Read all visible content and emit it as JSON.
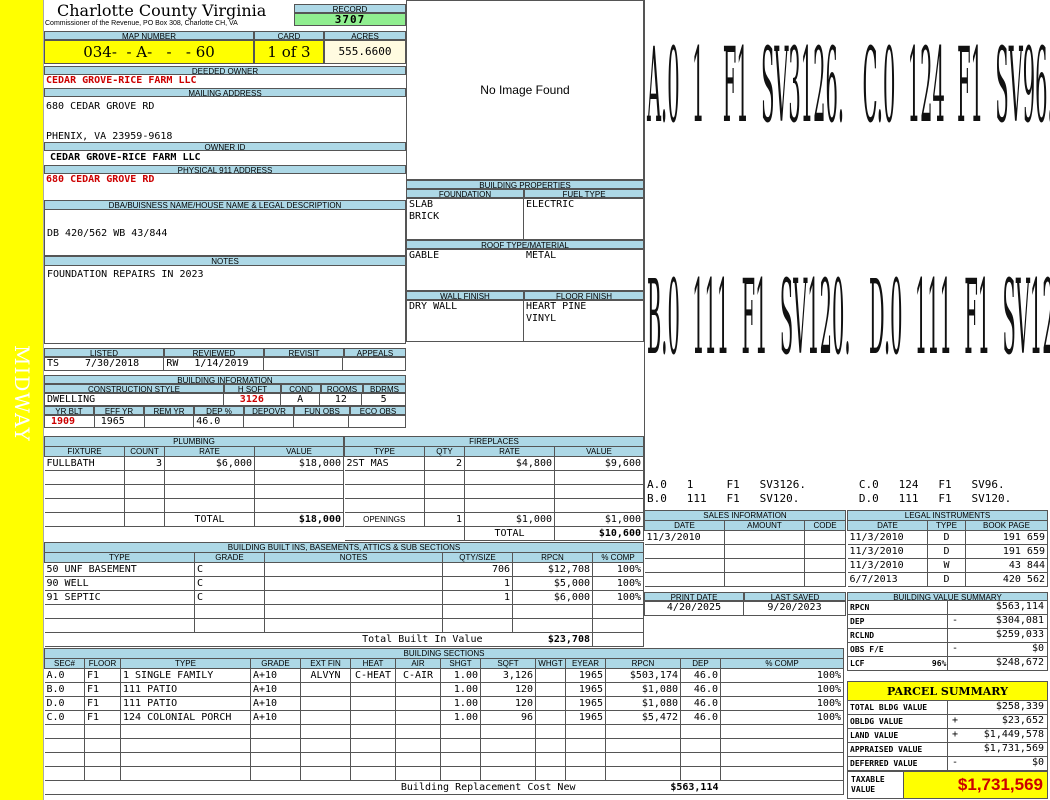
{
  "sidebar": {
    "label": "MIDWAY"
  },
  "header": {
    "county": "Charlotte County Virginia",
    "commissioner": "Commissioner of the Revenue, PO Box 308, Charlotte CH, VA",
    "record_label": "RECORD",
    "record": "3707",
    "map_label": "MAP NUMBER",
    "map_number": "034-  - A-   -   - 60",
    "card_label": "CARD",
    "card": "1 of 3",
    "acres_label": "ACRES",
    "acres": "555.6600"
  },
  "owner": {
    "deeded_label": "DEEDED OWNER",
    "deeded": "CEDAR GROVE-RICE FARM LLC",
    "mailing_label": "MAILING ADDRESS",
    "mail1": "680 CEDAR GROVE RD",
    "mail2": "PHENIX, VA 23959-9618",
    "ownerid_label": "OWNER ID",
    "ownerid": "CEDAR GROVE-RICE FARM LLC",
    "phys_label": "PHYSICAL 911 ADDRESS",
    "phys": "680 CEDAR GROVE RD"
  },
  "dba": {
    "label": "DBA/BUISNESS NAME/HOUSE NAME & LEGAL DESCRIPTION",
    "value": "DB 420/562 WB 43/844"
  },
  "notes": {
    "label": "NOTES",
    "value": "FOUNDATION REPAIRS IN 2023"
  },
  "image": {
    "text": "No Image Found"
  },
  "listed": {
    "listed_label": "LISTED",
    "reviewed_label": "REVIEWED",
    "revisit_label": "REVISIT",
    "appeals_label": "APPEALS",
    "listed_by": "TS",
    "listed_date": "7/30/2018",
    "reviewed_by": "RW",
    "reviewed_date": "1/14/2019"
  },
  "bldg_info": {
    "label": "BUILDING INFORMATION",
    "h_cs": "CONSTRUCTION STYLE",
    "h_hsqft": "H SQFT",
    "h_cond": "COND",
    "h_rooms": "ROOMS",
    "h_bdrms": "BDRMS",
    "style": "DWELLING",
    "hsqft": "3126",
    "cond": "A",
    "rooms": "12",
    "bdrms": "5",
    "h_yrblt": "YR BLT",
    "h_effyr": "EFF YR",
    "h_remyr": "REM YR",
    "h_dep": "DEP %",
    "h_depovr": "DEPOVR",
    "h_funobs": "FUN OBS",
    "h_ecoobs": "ECO OBS",
    "yrblt": "1909",
    "effyr": "1965",
    "remyr": "",
    "dep": "46.0"
  },
  "props": {
    "label": "BUILDING PROPERTIES",
    "foundation_label": "FOUNDATION",
    "fuel_label": "FUEL TYPE",
    "foundation1": "SLAB",
    "foundation2": "BRICK",
    "fuel": "ELECTRIC",
    "roof_label": "ROOF TYPE/MATERIAL",
    "roof1": "GABLE",
    "roof2": "METAL",
    "wall_label": "WALL FINISH",
    "floor_label": "FLOOR FINISH",
    "wall": "DRY WALL",
    "floor1": "HEART PINE",
    "floor2": "VINYL"
  },
  "sketch": {
    "line1": "A.0  1   F1  SV3126.   C.0  124  F1  SV96.",
    "line2": "B.0  111  F1  SV120.   D.0  111  F1  SV120.",
    "legend1": "A.0   1     F1   SV3126.        C.0   124   F1   SV96.",
    "legend2": "B.0   111   F1   SV120.         D.0   111   F1   SV120."
  },
  "plumbing": {
    "label": "PLUMBING",
    "h": [
      "FIXTURE",
      "COUNT",
      "RATE",
      "VALUE"
    ],
    "rows": [
      [
        "FULLBATH",
        "3",
        "$6,000",
        "$18,000"
      ],
      [
        "",
        "",
        "",
        ""
      ],
      [
        "",
        "",
        "",
        ""
      ],
      [
        "",
        "",
        "",
        ""
      ]
    ],
    "total_label": "TOTAL",
    "total": "$18,000"
  },
  "fireplaces": {
    "label": "FIREPLACES",
    "h": [
      "TYPE",
      "QTY",
      "RATE",
      "VALUE"
    ],
    "rows": [
      [
        "2ST MAS",
        "2",
        "$4,800",
        "$9,600"
      ],
      [
        "",
        "",
        "",
        ""
      ],
      [
        "",
        "",
        "",
        ""
      ],
      [
        "",
        "",
        "",
        ""
      ]
    ],
    "openings_label": "OPENINGS",
    "openings_qty": "1",
    "openings_rate": "$1,000",
    "openings_value": "$1,000",
    "total_label": "TOTAL",
    "total": "$10,600"
  },
  "sales": {
    "label": "SALES INFORMATION",
    "h": [
      "DATE",
      "AMOUNT",
      "CODE"
    ],
    "rows": [
      [
        "11/3/2010",
        "",
        ""
      ],
      [
        "",
        "",
        ""
      ],
      [
        "",
        "",
        ""
      ],
      [
        "",
        "",
        ""
      ]
    ]
  },
  "legal": {
    "label": "LEGAL INSTRUMENTS",
    "h": [
      "DATE",
      "TYPE",
      "BOOK PAGE"
    ],
    "rows": [
      [
        "11/3/2010",
        "D",
        "191 659"
      ],
      [
        "11/3/2010",
        "D",
        "191 659"
      ],
      [
        "11/3/2010",
        "W",
        "43 844"
      ],
      [
        "6/7/2013",
        "D",
        "420 562"
      ]
    ]
  },
  "builtins": {
    "label": "BUILDING BUILT INS, BASEMENTS, ATTICS & SUB SECTIONS",
    "h": [
      "TYPE",
      "GRADE",
      "NOTES",
      "QTY/SIZE",
      "RPCN",
      "% COMP"
    ],
    "rows": [
      [
        "50 UNF BASEMENT",
        "C",
        "",
        "706",
        "$12,708",
        "100%"
      ],
      [
        "90 WELL",
        "C",
        "",
        "1",
        "$5,000",
        "100%"
      ],
      [
        "91 SEPTIC",
        "C",
        "",
        "1",
        "$6,000",
        "100%"
      ],
      [
        "",
        "",
        "",
        "",
        "",
        ""
      ],
      [
        "",
        "",
        "",
        "",
        "",
        ""
      ]
    ],
    "total_label": "Total Built In Value",
    "total": "$23,708"
  },
  "dates": {
    "print_label": "PRINT DATE",
    "saved_label": "LAST SAVED",
    "print": "4/20/2025",
    "saved": "9/20/2023"
  },
  "bvs": {
    "label": "BUILDING VALUE SUMMARY",
    "rows": [
      [
        "RPCN",
        "",
        "$563,114"
      ],
      [
        "DEP",
        "-",
        "$304,081"
      ],
      [
        "RCLND",
        "",
        "$259,033"
      ],
      [
        "OBS F/E",
        "-",
        "$0"
      ],
      [
        "LCF              96%",
        "",
        "$248,672"
      ]
    ]
  },
  "sections": {
    "label": "BUILDING SECTIONS",
    "h": [
      "SEC#",
      "FLOOR",
      "TYPE",
      "GRADE",
      "EXT FIN",
      "HEAT",
      "AIR",
      "SHGT",
      "SQFT",
      "WHGT",
      "EYEAR",
      "RPCN",
      "DEP",
      "% COMP"
    ],
    "rows": [
      [
        "A.0",
        "F1",
        "1 SINGLE FAMILY",
        "A+10",
        "ALVYN",
        "C-HEAT",
        "C-AIR",
        "1.00",
        "3,126",
        "",
        "1965",
        "$503,174",
        "46.0",
        "100%"
      ],
      [
        "B.0",
        "F1",
        "111 PATIO",
        "A+10",
        "",
        "",
        "",
        "1.00",
        "120",
        "",
        "1965",
        "$1,080",
        "46.0",
        "100%"
      ],
      [
        "D.0",
        "F1",
        "111 PATIO",
        "A+10",
        "",
        "",
        "",
        "1.00",
        "120",
        "",
        "1965",
        "$1,080",
        "46.0",
        "100%"
      ],
      [
        "C.0",
        "F1",
        "124 COLONIAL PORCH",
        "A+10",
        "",
        "",
        "",
        "1.00",
        "96",
        "",
        "1965",
        "$5,472",
        "46.0",
        "100%"
      ],
      [
        "",
        "",
        "",
        "",
        "",
        "",
        "",
        "",
        "",
        "",
        "",
        "",
        "",
        ""
      ],
      [
        "",
        "",
        "",
        "",
        "",
        "",
        "",
        "",
        "",
        "",
        "",
        "",
        "",
        ""
      ],
      [
        "",
        "",
        "",
        "",
        "",
        "",
        "",
        "",
        "",
        "",
        "",
        "",
        "",
        ""
      ],
      [
        "",
        "",
        "",
        "",
        "",
        "",
        "",
        "",
        "",
        "",
        "",
        "",
        "",
        ""
      ]
    ],
    "brcn_label": "Building Replacement Cost New",
    "brcn": "$563,114"
  },
  "parcel": {
    "title": "PARCEL SUMMARY",
    "rows": [
      [
        "TOTAL BLDG VALUE",
        "",
        "$258,339"
      ],
      [
        "OBLDG VALUE",
        "+",
        "$23,652"
      ],
      [
        "LAND VALUE",
        "+",
        "$1,449,578"
      ],
      [
        "APPRAISED VALUE",
        "",
        "$1,731,569"
      ],
      [
        "DEFERRED VALUE",
        "-",
        "$0"
      ]
    ],
    "taxable_label": "TAXABLE VALUE",
    "taxable": "$1,731,569"
  },
  "colors": {
    "yellow": "#ffff00",
    "header_blue": "#add8e6",
    "record_green": "#90ee90",
    "red": "#c00000"
  }
}
